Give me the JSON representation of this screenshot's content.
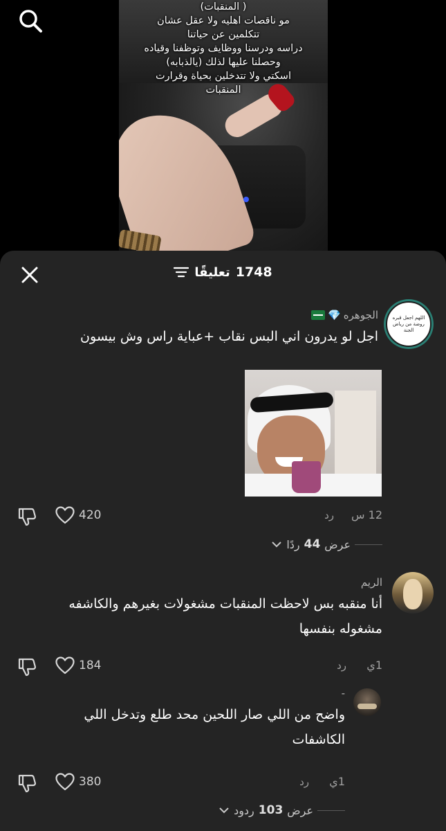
{
  "video": {
    "overlay_lines": [
      "( المنقبات)",
      "مو ناقصات اهليه ولا عقل عشان",
      "تتكلمين عن حياتنا",
      "دراسه ودرسنا ووظايف وتوظفنا وقياده",
      "وحصلنا عليها لذلك (يالذبابه)",
      "اسكتي ولا تتدخلين بحياة وقرارت",
      "المنقبات"
    ]
  },
  "header": {
    "count": "1748",
    "label": "تعليقًا"
  },
  "comments": [
    {
      "username": "الجوهره",
      "badges": [
        "💎",
        "🇸🇦"
      ],
      "avatar_text": "اللهم اجعل قبره روضة من رياض الجنة",
      "text": "اجل لو يدرون اني البس نقاب +عباية راس وش بيسون",
      "time": "12 س",
      "reply_label": "رد",
      "likes": "420",
      "view_replies": {
        "prefix": "عرض",
        "count": "44",
        "suffix": "ردًا"
      }
    },
    {
      "username": "الريم",
      "text_lines": [
        "أنا منقبه بس لاحظت المنقبات مشغولات بغيرهم والكاشفه",
        "مشغوله بنفسها"
      ],
      "time": "1ي",
      "reply_label": "رد",
      "likes": "184"
    },
    {
      "username": "-",
      "text_lines": [
        "واضح من اللي صار اللحين محد طلع وتدخل اللي",
        "الكاشفات"
      ],
      "time": "1ي",
      "reply_label": "رد",
      "likes": "380",
      "view_replies": {
        "prefix": "عرض",
        "count": "103",
        "suffix": "ردود"
      }
    }
  ],
  "icons": {
    "search": "search-icon",
    "close": "close-icon",
    "filter": "filter-icon",
    "heart": "heart-icon",
    "dislike": "thumbs-down-icon",
    "chevron": "chevron-down-icon"
  }
}
